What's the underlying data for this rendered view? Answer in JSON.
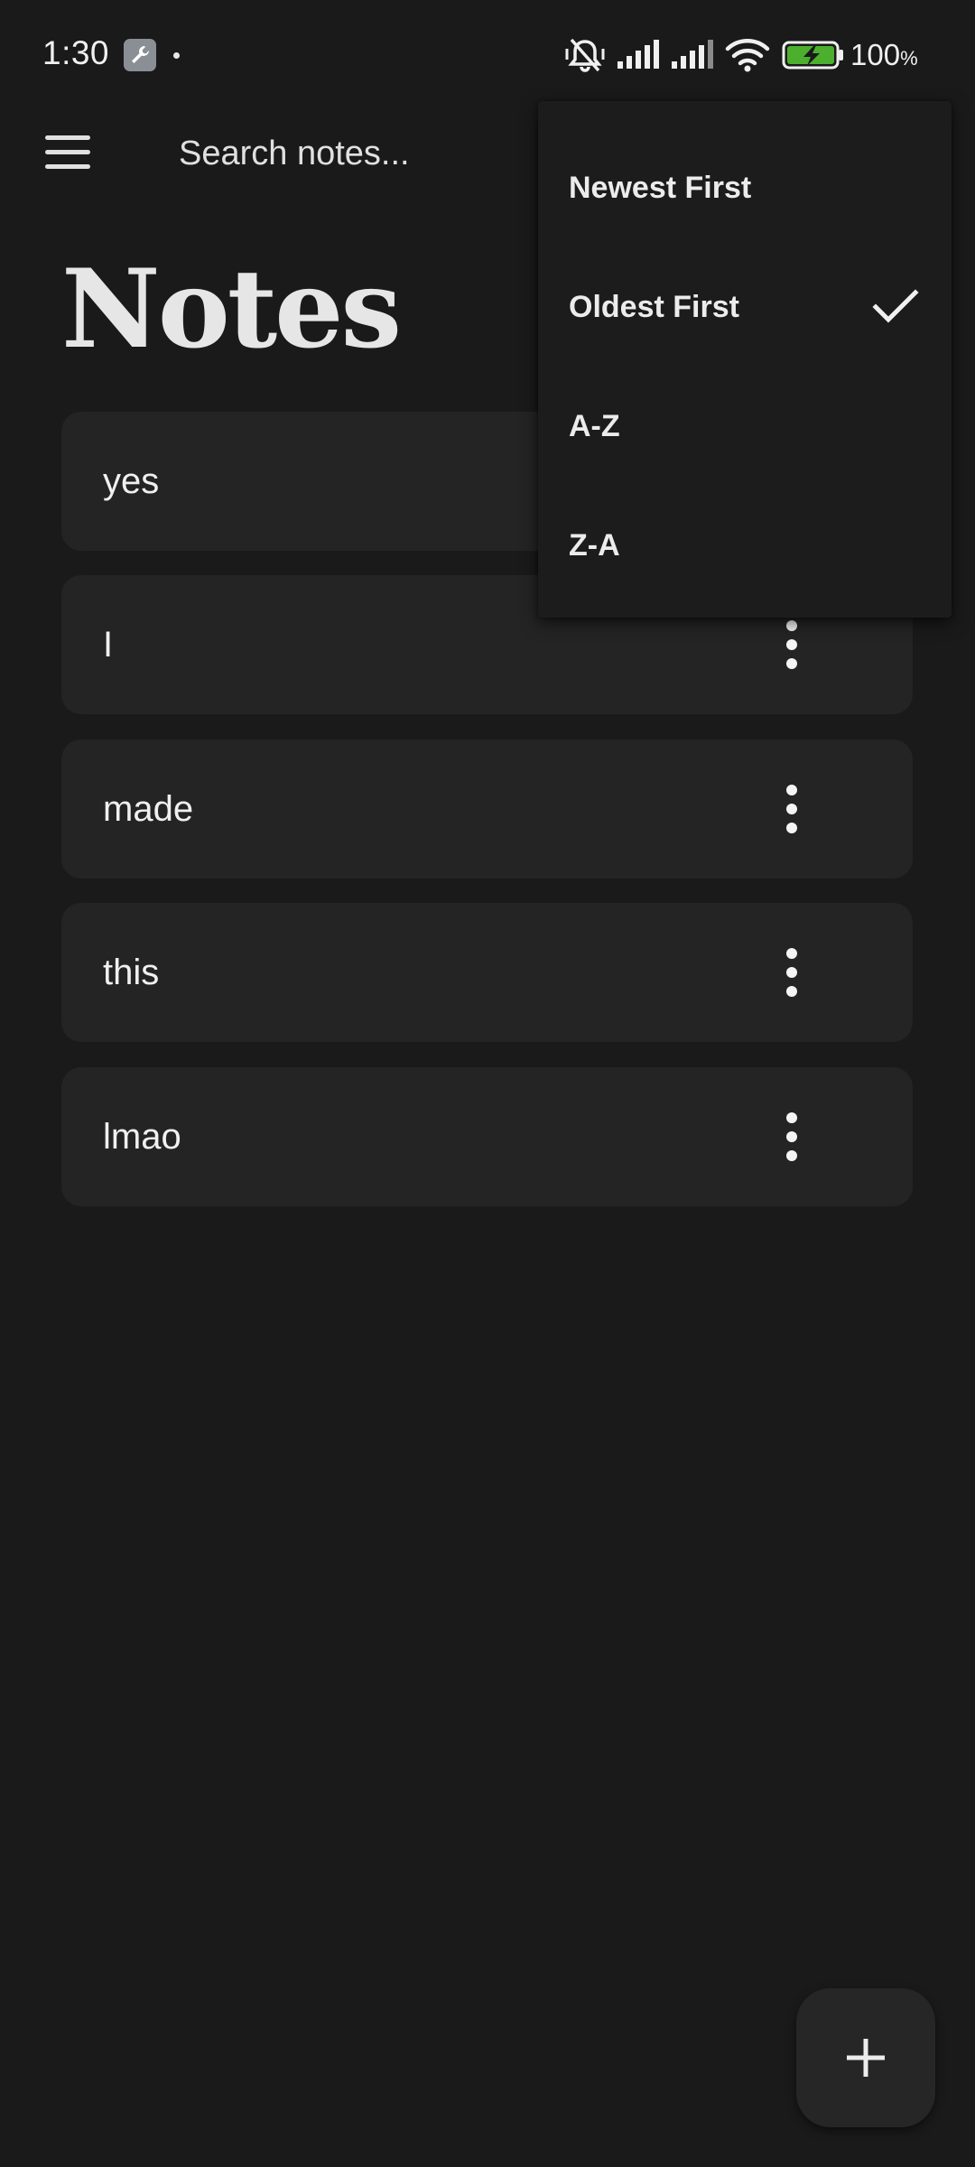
{
  "status_bar": {
    "time": "1:30",
    "battery_percent": "100",
    "battery_unit": "%",
    "icons": [
      "wrench-icon",
      "notification-dot",
      "silent-bell-icon",
      "signal-icon",
      "signal-icon",
      "wifi-icon",
      "battery-charging-icon"
    ]
  },
  "top_bar": {
    "menu_icon": "hamburger-menu-icon",
    "search_placeholder": "Search notes..."
  },
  "page_title": "Notes",
  "notes": [
    {
      "title": "yes"
    },
    {
      "title": "I"
    },
    {
      "title": "made"
    },
    {
      "title": "this"
    },
    {
      "title": "lmao"
    }
  ],
  "sort_menu": {
    "options": [
      {
        "label": "Newest First",
        "selected": false
      },
      {
        "label": "Oldest First",
        "selected": true
      },
      {
        "label": "A-Z",
        "selected": false
      },
      {
        "label": "Z-A",
        "selected": false
      }
    ]
  },
  "fab": {
    "icon": "plus-icon"
  },
  "colors": {
    "background": "#1a1a1a",
    "card": "#242424",
    "menu": "#1c1c1c",
    "text": "#ebebeb",
    "battery_fill": "#4caf2e"
  }
}
